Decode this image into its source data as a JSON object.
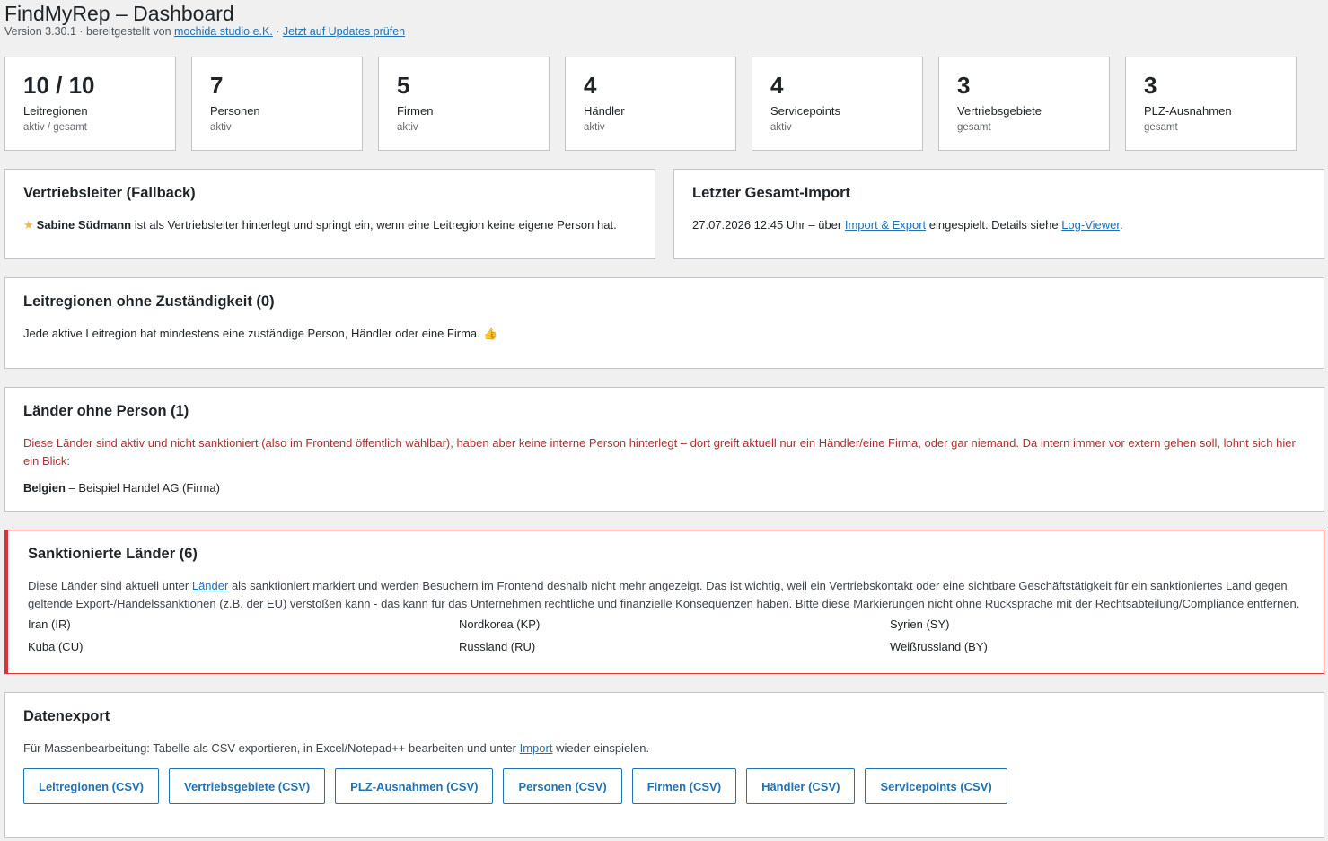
{
  "header": {
    "title": "FindMyRep – Dashboard",
    "version_prefix": "Version 3.30.1 · bereitgestellt von ",
    "vendor_link": "mochida studio e.K.",
    "sep": " · ",
    "updates_link": "Jetzt auf Updates prüfen"
  },
  "stats": [
    {
      "num": "10 / 10",
      "label": "Leitregionen",
      "sub": "aktiv / gesamt"
    },
    {
      "num": "7",
      "label": "Personen",
      "sub": "aktiv"
    },
    {
      "num": "5",
      "label": "Firmen",
      "sub": "aktiv"
    },
    {
      "num": "4",
      "label": "Händler",
      "sub": "aktiv"
    },
    {
      "num": "4",
      "label": "Servicepoints",
      "sub": "aktiv"
    },
    {
      "num": "3",
      "label": "Vertriebsgebiete",
      "sub": "gesamt"
    },
    {
      "num": "3",
      "label": "PLZ-Ausnahmen",
      "sub": "gesamt"
    }
  ],
  "fallback": {
    "title": "Vertriebsleiter (Fallback)",
    "name": "Sabine Südmann",
    "text": " ist als Vertriebsleiter hinterlegt und springt ein, wenn eine Leitregion keine eigene Person hat."
  },
  "import": {
    "title": "Letzter Gesamt-Import",
    "prefix": "27.07.2026 12:45 Uhr – über ",
    "link1": "Import & Export",
    "middle": " eingespielt. Details siehe ",
    "link2": "Log-Viewer",
    "suffix": "."
  },
  "regions": {
    "title": "Leitregionen ohne Zuständigkeit (0)",
    "text": "Jede aktive Leitregion hat mindestens eine zuständige Person, Händler oder eine Firma. 👍"
  },
  "countries": {
    "title": "Länder ohne Person (1)",
    "warning": "Diese Länder sind aktiv und nicht sanktioniert (also im Frontend öffentlich wählbar), haben aber keine interne Person hinterlegt – dort greift aktuell nur ein Händler/eine Firma, oder gar niemand. Da intern immer vor extern gehen soll, lohnt sich hier ein Blick:",
    "item_country": "Belgien",
    "item_rest": " – Beispiel Handel AG (Firma)"
  },
  "sanctioned": {
    "title": "Sanktionierte Länder (6)",
    "prefix": "Diese Länder sind aktuell unter ",
    "link": "Länder",
    "text": " als sanktioniert markiert und werden Besuchern im Frontend deshalb nicht mehr angezeigt. Das ist wichtig, weil ein Vertriebskontakt oder eine sichtbare Geschäftstätigkeit für ein sanktioniertes Land gegen geltende Export-/Handelssanktionen (z.B. der EU) verstoßen kann - das kann für das Unternehmen rechtliche und finanzielle Konsequenzen haben. Bitte diese Markierungen nicht ohne Rücksprache mit der Rechtsabteilung/Compliance entfernen.",
    "list": [
      "Iran (IR)",
      "Nordkorea (KP)",
      "Syrien (SY)",
      "Kuba (CU)",
      "Russland (RU)",
      "Weißrussland (BY)"
    ]
  },
  "export": {
    "title": "Datenexport",
    "prefix": "Für Massenbearbeitung: Tabelle als CSV exportieren, in Excel/Notepad++ bearbeiten und unter ",
    "link": "Import",
    "suffix": " wieder einspielen.",
    "buttons": [
      "Leitregionen (CSV)",
      "Vertriebsgebiete (CSV)",
      "PLZ-Ausnahmen (CSV)",
      "Personen (CSV)",
      "Firmen (CSV)",
      "Händler (CSV)",
      "Servicepoints (CSV)"
    ]
  },
  "colors": {
    "accent": "#2271b1",
    "danger": "#d63638",
    "warning_text": "#b32d2e",
    "star": "#f0b849"
  }
}
